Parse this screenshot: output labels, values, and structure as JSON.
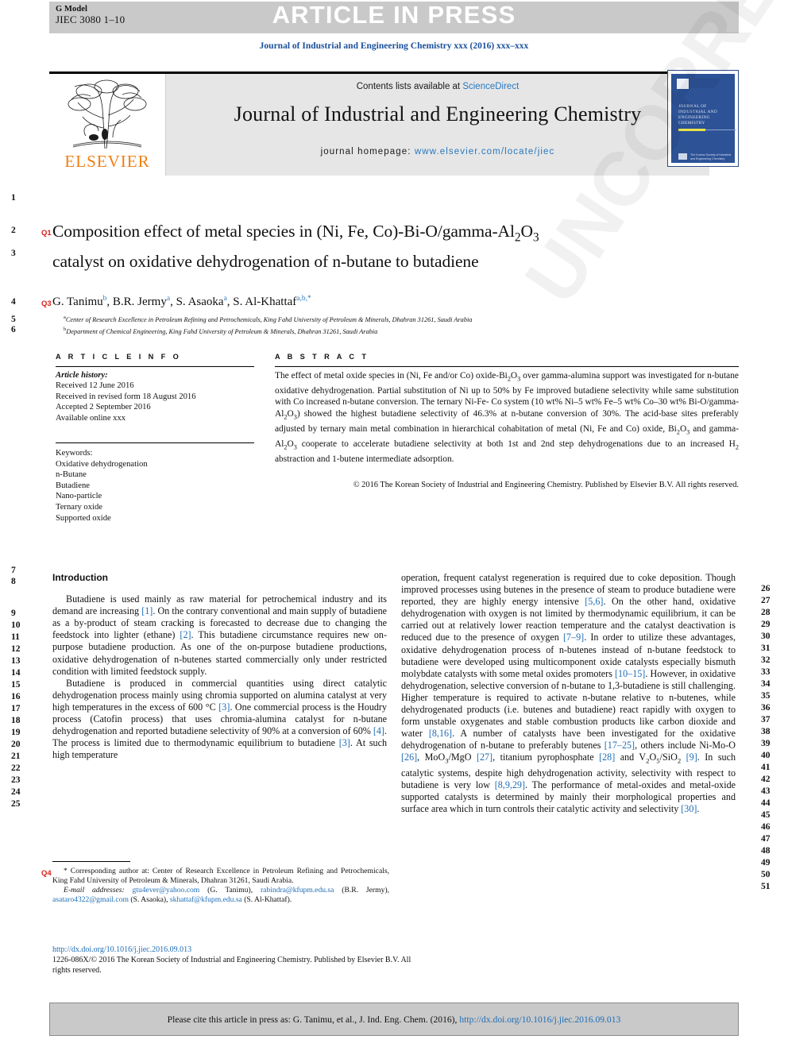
{
  "header": {
    "g_model_label": "G Model",
    "manuscript_id": "JIEC 3080 1–10",
    "article_in_press": "ARTICLE IN PRESS",
    "running_head": "Journal of Industrial and Engineering Chemistry xxx (2016) xxx–xxx"
  },
  "masthead": {
    "contents_prefix": "Contents lists available at ",
    "sciencedirect": "ScienceDirect",
    "journal_title": "Journal of Industrial and Engineering Chemistry",
    "homepage_label": "journal homepage: ",
    "homepage_url": "www.elsevier.com/locate/jiec",
    "publisher_logo_text": "ELSEVIER",
    "cover_title": "JOURNAL OF INDUSTRIAL AND ENGINEERING CHEMISTRY",
    "cover_footer": "The Korean Society of Industrial and Engineering Chemistry"
  },
  "article": {
    "title_line1": "Composition effect of metal species in (Ni, Fe, Co)-Bi-O/gamma-Al",
    "title_line1_sub1": "2",
    "title_line1_mid": "O",
    "title_line1_sub2": "3",
    "title_line2": "catalyst on oxidative dehydrogenation of n-butane to butadiene",
    "authors": "G. Tanimu b, B.R. Jermy a, S. Asaoka a, S. Al-Khattaf a,b,*",
    "affiliation_a": "Center of Research Excellence in Petroleum Refining and Petrochemicals, King Fahd University of Petroleum & Minerals, Dhahran 31261, Saudi Arabia",
    "affiliation_b": "Department of Chemical Engineering, King Fahd University of Petroleum & Minerals, Dhahran 31261, Saudi Arabia"
  },
  "queries": {
    "q1": "Q1",
    "q3": "Q3",
    "q4": "Q4"
  },
  "article_info": {
    "heading": "A R T I C L E   I N F O",
    "history_label": "Article history:",
    "received": "Received 12 June 2016",
    "revised": "Received in revised form 18 August 2016",
    "accepted": "Accepted 2 September 2016",
    "online": "Available online xxx",
    "keywords_label": "Keywords:",
    "keywords": [
      "Oxidative dehydrogenation",
      "n-Butane",
      "Butadiene",
      "Nano-particle",
      "Ternary oxide",
      "Supported oxide"
    ]
  },
  "abstract": {
    "heading": "A B S T R A C T",
    "body": "The effect of metal oxide species in (Ni, Fe and/or Co) oxide-Bi2O3 over gamma-alumina support was investigated for n-butane oxidative dehydrogenation. Partial substitution of Ni up to 50% by Fe improved butadiene selectivity while same substitution with Co increased n-butane conversion. The ternary Ni-Fe-Co system (10 wt% Ni–5 wt% Fe–5 wt% Co–30 wt% Bi-O/gamma-Al2O3) showed the highest butadiene selectivity of 46.3% at n-butane conversion of 30%. The acid-base sites preferably adjusted by ternary main metal combination in hierarchical cohabitation of metal (Ni, Fe and Co) oxide, Bi2O3 and gamma-Al2O3 cooperate to accelerate butadiene selectivity at both 1st and 2nd step dehydrogenations due to an increased H2 abstraction and 1-butene intermediate adsorption.",
    "copyright": "© 2016 The Korean Society of Industrial and Engineering Chemistry. Published by Elsevier B.V. All rights reserved."
  },
  "body": {
    "section_title": "Introduction",
    "left_paragraphs": [
      "Butadiene is used mainly as raw material for petrochemical industry and its demand are increasing [1]. On the contrary conventional and main supply of butadiene as a by-product of steam cracking is forecasted to decrease due to changing the feedstock into lighter (ethane) [2]. This butadiene circumstance requires new on-purpose butadiene production. As one of the on-purpose butadiene productions, oxidative dehydrogenation of n-butenes started commercially only under restricted condition with limited feedstock supply.",
      "Butadiene is produced in commercial quantities using direct catalytic dehydrogenation process mainly using chromia supported on alumina catalyst at very high temperatures in the excess of 600 °C [3]. One commercial process is the Houdry process (Catofin process) that uses chromia-alumina catalyst for n-butane dehydrogenation and reported butadiene selectivity of 90% at a conversion of 60% [4]. The process is limited due to thermodynamic equilibrium to butadiene [3]. At such high temperature"
    ],
    "right_paragraphs": [
      "operation, frequent catalyst regeneration is required due to coke deposition. Though improved processes using butenes in the presence of steam to produce butadiene were reported, they are highly energy intensive [5,6]. On the other hand, oxidative dehydrogenation with oxygen is not limited by thermodynamic equilibrium, it can be carried out at relatively lower reaction temperature and the catalyst deactivation is reduced due to the presence of oxygen [7–9]. In order to utilize these advantages, oxidative dehydrogenation process of n-butenes instead of n-butane feedstock to butadiene were developed using multicomponent oxide catalysts especially bismuth molybdate catalysts with some metal oxides promoters [10–15]. However, in oxidative dehydrogenation, selective conversion of n-butane to 1,3-butadiene is still challenging. Higher temperature is required to activate n-butane relative to n-butenes, while dehydrogenated products (i.e. butenes and butadiene) react rapidly with oxygen to form unstable oxygenates and stable combustion products like carbon dioxide and water [8,16]. A number of catalysts have been investigated for the oxidative dehydrogenation of n-butane to preferably butenes [17–25], others include Ni-Mo-O [26], MoO3/MgO [27], titanium pyrophosphate [28] and V2O5/SiO2 [9]. In such catalytic systems, despite high dehydrogenation activity, selectivity with respect to butadiene is very low [8,9,29]. The performance of metal-oxides and metal-oxide supported catalysts is determined by mainly their morphological properties and surface area which in turn controls their catalytic activity and selectivity [30]."
    ]
  },
  "footnote": {
    "corresponding": "* Corresponding author at: Center of Research Excellence in Petroleum Refining and Petrochemicals, King Fahd University of Petroleum & Minerals, Dhahran 31261, Saudi Arabia.",
    "email_label": "E-mail addresses:",
    "emails": [
      {
        "address": "gtu4ever@yahoo.com",
        "name": "(G. Tanimu)"
      },
      {
        "address": "rabindra@kfupm.edu.sa",
        "name": "(B.R. Jermy)"
      },
      {
        "address": "asataro4322@gmail.com",
        "name": "(S. Asaoka)"
      },
      {
        "address": "skhattaf@kfupm.edu.sa",
        "name": "(S. Al-Khattaf)."
      }
    ],
    "doi_url": "http://dx.doi.org/10.1016/j.jiec.2016.09.013",
    "issn_line": "1226-086X/© 2016 The Korean Society of Industrial and Engineering Chemistry. Published by Elsevier B.V. All rights reserved."
  },
  "cite_bar": {
    "text": "Please cite this article in press as: G. Tanimu, et al., J. Ind. Eng. Chem. (2016), ",
    "doi": "http://dx.doi.org/10.1016/j.jiec.2016.09.013"
  },
  "line_numbers": {
    "left": [
      "1",
      "2",
      "3",
      "4",
      "5",
      "6",
      "7",
      "8",
      "9",
      "10",
      "11",
      "12",
      "13",
      "14",
      "15",
      "16",
      "17",
      "18",
      "19",
      "20",
      "21",
      "22",
      "23",
      "24",
      "25"
    ],
    "right": [
      "26",
      "27",
      "28",
      "29",
      "30",
      "31",
      "32",
      "33",
      "34",
      "35",
      "36",
      "37",
      "38",
      "39",
      "40",
      "41",
      "42",
      "43",
      "44",
      "45",
      "46",
      "47",
      "48",
      "49",
      "50",
      "51"
    ]
  },
  "watermark": "UNCORRECTED PROOF",
  "colors": {
    "link": "#1f6db5",
    "journal_blue": "#1a4f9c",
    "elsevier_orange": "#f07f13",
    "query_red": "#d8221a",
    "band_gray": "#c9c9c9"
  }
}
